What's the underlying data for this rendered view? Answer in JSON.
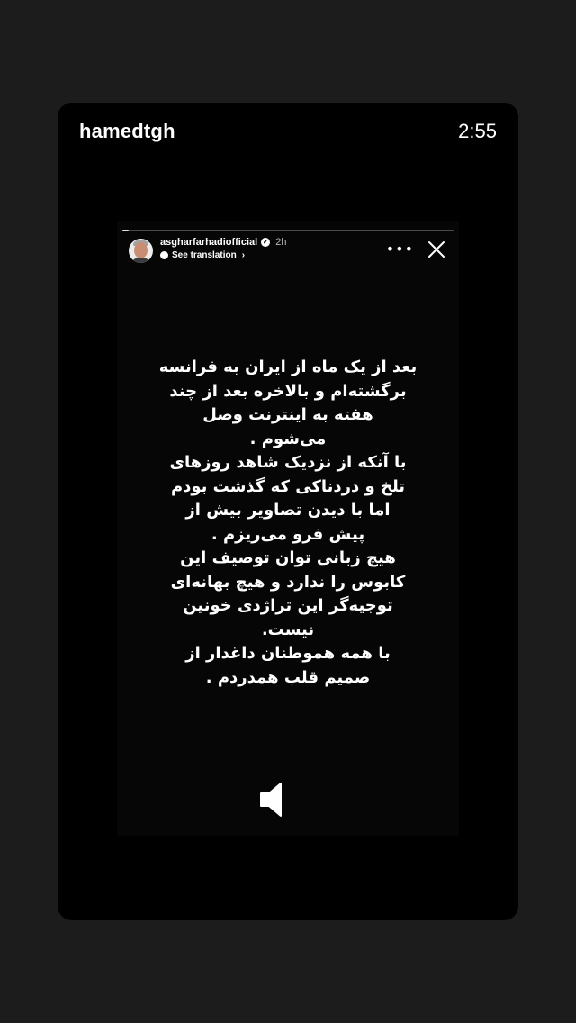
{
  "header": {
    "username": "hamedtgh",
    "duration": "2:55"
  },
  "story": {
    "progress": 0.02,
    "account": {
      "name": "asgharfarhadiofficial",
      "verified": true,
      "time_ago": "2h",
      "translation_label": "See translation",
      "avatar": "avatar"
    },
    "icons": {
      "more": "more-icon",
      "close": "close-icon",
      "sound": "sound-icon"
    },
    "lines": [
      "بعد از یک ماه از ایران به فرانسه",
      "برگشته‌ام و بالاخره بعد از چند",
      "هفته به اینترنت وصل",
      "می‌شوم .",
      "با آنکه از نزدیک شاهد روزهای",
      "تلخ و دردناکی که گذشت بودم",
      "اما با دیدن تصاویر بیش از",
      "پیش فرو می‌ریزم .",
      "هیچ زبانی توان توصیف این",
      "کابوس را ندارد و هیچ بهانه‌ای",
      "توجیه‌گر این تراژدی خونین",
      "نیست.",
      "با همه هموطنان داغدار از",
      "صمیم قلب همدردم ."
    ]
  }
}
